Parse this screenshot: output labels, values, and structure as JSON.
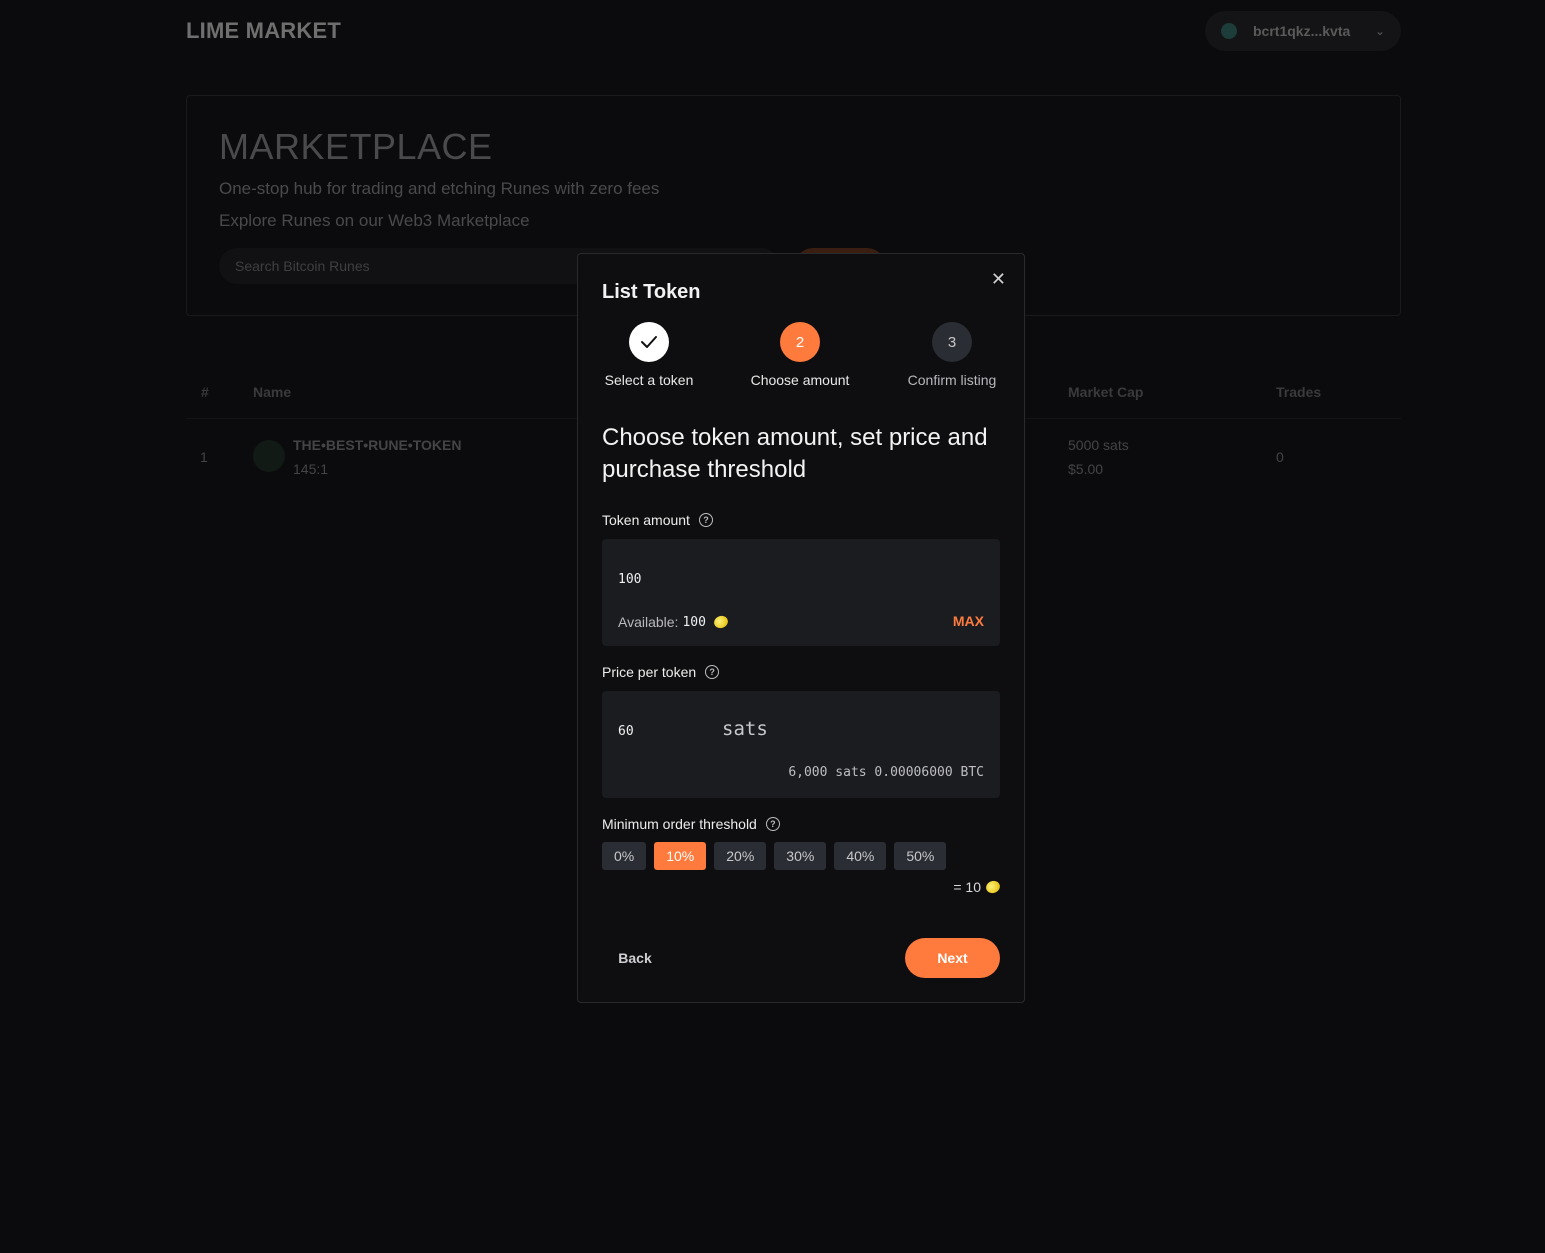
{
  "app": {
    "logo": "LIME MARKET",
    "wallet_address": "bcrt1qkz...kvta"
  },
  "hero": {
    "title": "MARKETPLACE",
    "subtitle1": "One-stop hub for trading and etching Runes with zero fees",
    "subtitle2": "Explore Runes on our Web3 Marketplace",
    "search_placeholder": "Search Bitcoin Runes"
  },
  "table": {
    "headers": {
      "index": "#",
      "name": "Name",
      "market_cap": "Market Cap",
      "trades": "Trades"
    },
    "rows": [
      {
        "index": "1",
        "name": "THE•BEST•RUNE•TOKEN",
        "id": "145:1",
        "market_cap_sats": "5000 sats",
        "market_cap_usd": "$5.00",
        "trades": "0"
      }
    ]
  },
  "modal": {
    "title": "List Token",
    "steps": [
      {
        "label": "Select a token",
        "number": "",
        "state": "done"
      },
      {
        "label": "Choose amount",
        "number": "2",
        "state": "active"
      },
      {
        "label": "Confirm listing",
        "number": "3",
        "state": "todo"
      }
    ],
    "heading": "Choose token amount, set price and purchase threshold",
    "token_amount": {
      "label": "Token amount",
      "value": "100",
      "available_label": "Available:",
      "available_value": "100",
      "max_label": "MAX"
    },
    "price": {
      "label": "Price per token",
      "value": "60",
      "unit": "sats",
      "conversion": "6,000 sats 0.00006000 BTC"
    },
    "threshold": {
      "label": "Minimum order threshold",
      "options": [
        "0%",
        "10%",
        "20%",
        "30%",
        "40%",
        "50%"
      ],
      "selected": "10%",
      "result": "= 10"
    },
    "back_label": "Back",
    "next_label": "Next"
  },
  "colors": {
    "accent": "#ff7a3d",
    "background": "#0b0b0d",
    "modal": "#0e0e10",
    "field": "#1b1c20"
  }
}
